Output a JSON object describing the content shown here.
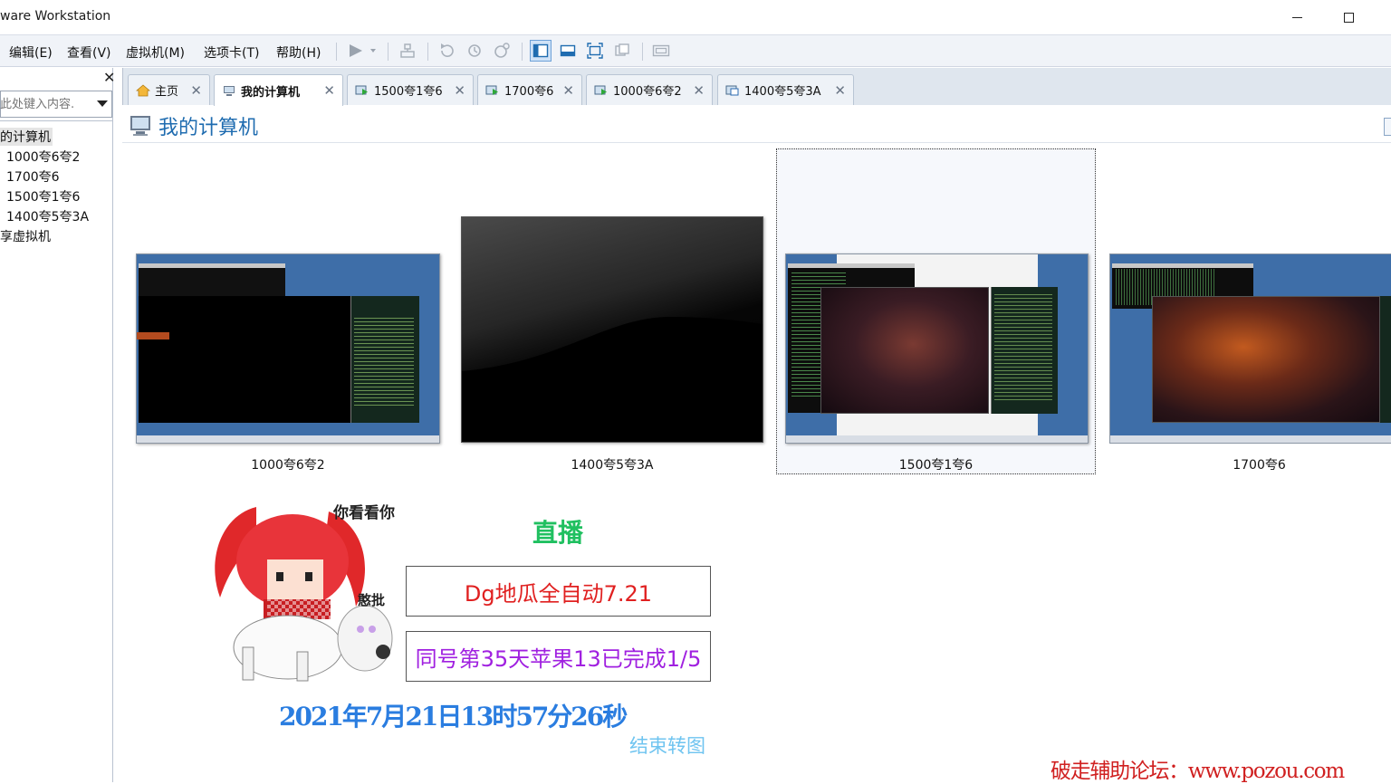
{
  "window": {
    "title": "ware Workstation"
  },
  "menu": [
    "编辑(E)",
    "查看(V)",
    "虚拟机(M)",
    "选项卡(T)",
    "帮助(H)"
  ],
  "sidebar": {
    "search_placeholder": "在此处键入内容...",
    "items": [
      "我的计算机",
      "1000夸6夸2",
      "1700夸6",
      "1500夸1夸6",
      "1400夸5夸3A",
      "共享虚拟机"
    ]
  },
  "tabs": [
    {
      "label": "主页"
    },
    {
      "label": "我的计算机"
    },
    {
      "label": "1500夸1夸6"
    },
    {
      "label": "1700夸6"
    },
    {
      "label": "1000夸6夸2"
    },
    {
      "label": "1400夸5夸3A"
    }
  ],
  "page": {
    "title": "我的计算机"
  },
  "vms": [
    {
      "name": "1000夸6夸2"
    },
    {
      "name": "1400夸5夸3A"
    },
    {
      "name": "1500夸1夸6"
    },
    {
      "name": "1700夸6"
    }
  ],
  "overlay": {
    "meme_top": "你看看你",
    "meme_mid": "憨批",
    "live": "直播",
    "box1": "Dg地瓜全自动7.21",
    "box2": "同号第35天苹果13已完成1/5",
    "datetime": "2021年7月21日13时57分26秒",
    "end": "结束转图",
    "watermark": "破走辅助论坛：www.pozou.com"
  },
  "colors": {
    "accent": "#1f6cb0",
    "live": "#20c060",
    "box1": "#e02020",
    "box2": "#a020e0",
    "datetime": "#2a7de0",
    "watermark": "#d02020"
  }
}
